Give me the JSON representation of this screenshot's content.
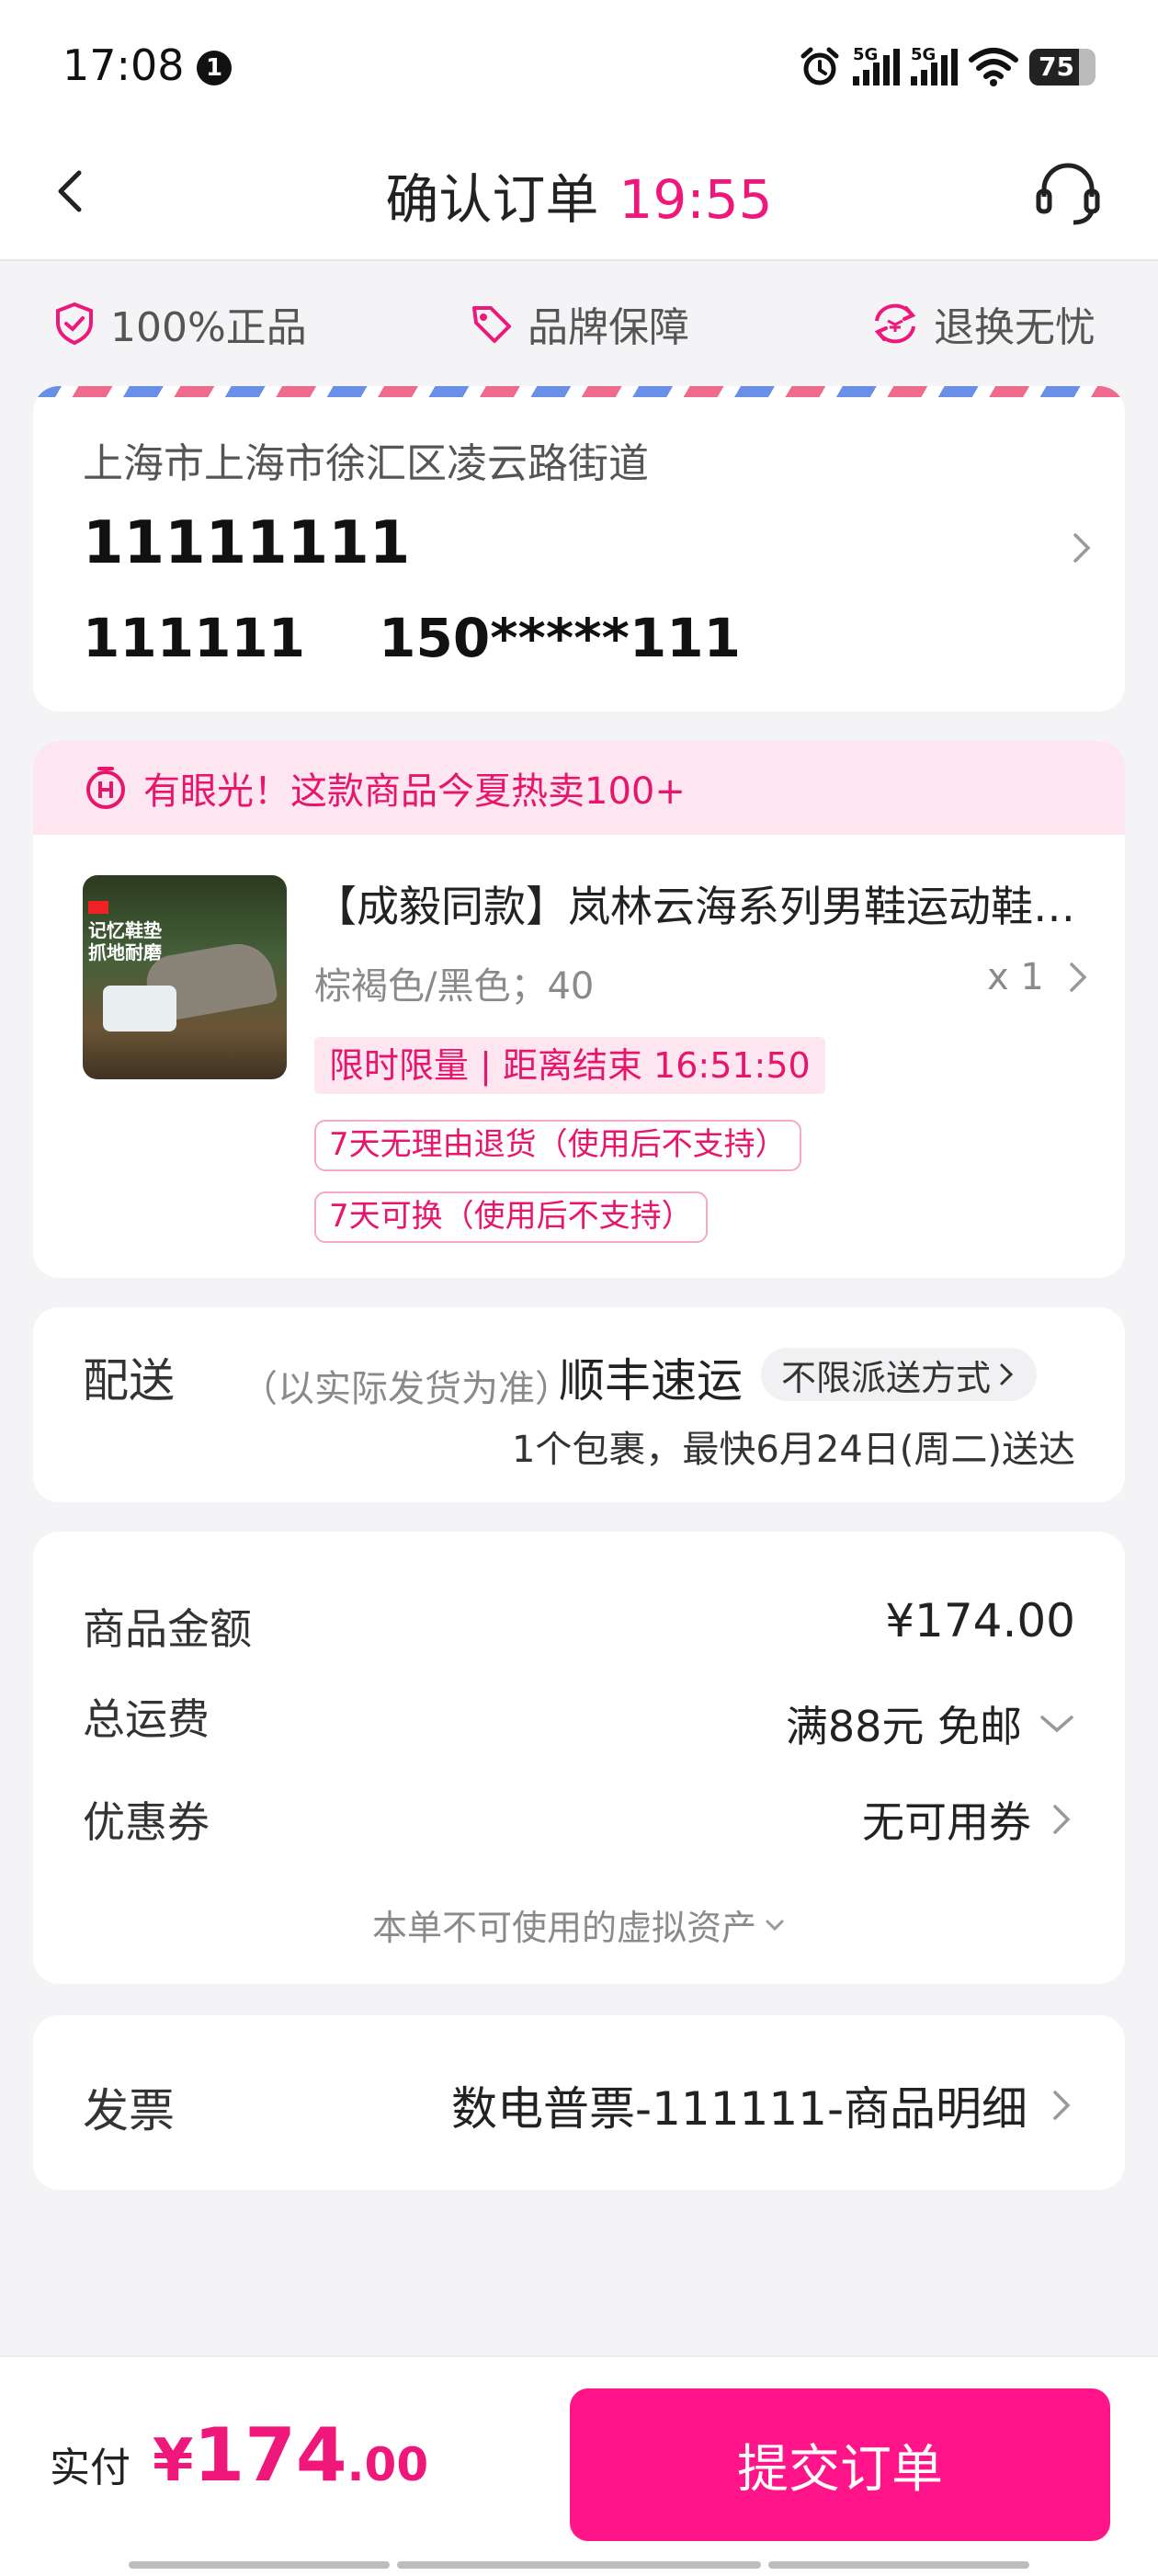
{
  "status_bar": {
    "time": "17:08",
    "notification_count": "1",
    "signal1_label": "5G",
    "signal2_label": "5G",
    "battery_level": "75"
  },
  "header": {
    "title": "确认订单",
    "countdown": "19:55"
  },
  "guarantees": [
    {
      "label": "100%正品",
      "icon": "shield-check-icon"
    },
    {
      "label": "品牌保障",
      "icon": "tag-icon"
    },
    {
      "label": "退换无忧",
      "icon": "exchange-icon"
    }
  ],
  "address": {
    "line": "上海市上海市徐汇区凌云路街道",
    "name": "11111111",
    "receiver": "111111",
    "phone": "150*****111"
  },
  "promo": {
    "banner": "有眼光！这款商品今夏热卖100+"
  },
  "product": {
    "title": "【成毅同款】岚林云海系列男鞋运动鞋…",
    "spec": "棕褐色/黑色；40",
    "quantity": "x 1",
    "flash_sale": "限时限量 | 距离结束 16:51:50",
    "tags": [
      "7天无理由退货（使用后不支持）",
      "7天可换（使用后不支持）"
    ],
    "image_text": [
      "记忆鞋垫",
      "抓地耐磨"
    ]
  },
  "shipping": {
    "label": "配送",
    "note": "（以实际发货为准）",
    "carrier": "顺丰速运",
    "mode": "不限派送方式",
    "eta": "1个包裹，最快6月24日(周二)送达"
  },
  "pricing": {
    "goods_label": "商品金额",
    "goods_value": "¥174.00",
    "freight_label": "总运费",
    "freight_value": "满88元 免邮",
    "coupon_label": "优惠券",
    "coupon_value": "无可用券",
    "virtual_assets": "本单不可使用的虚拟资产"
  },
  "invoice": {
    "label": "发票",
    "value": "数电普票-111111-商品明细"
  },
  "footer": {
    "pay_label": "实付",
    "currency": "¥",
    "amount_int": "174",
    "amount_dec": ".00",
    "submit_label": "提交订单"
  },
  "colors": {
    "accent": "#f0177a",
    "button": "#ff1489",
    "promo_bg": "#fde6ef"
  }
}
